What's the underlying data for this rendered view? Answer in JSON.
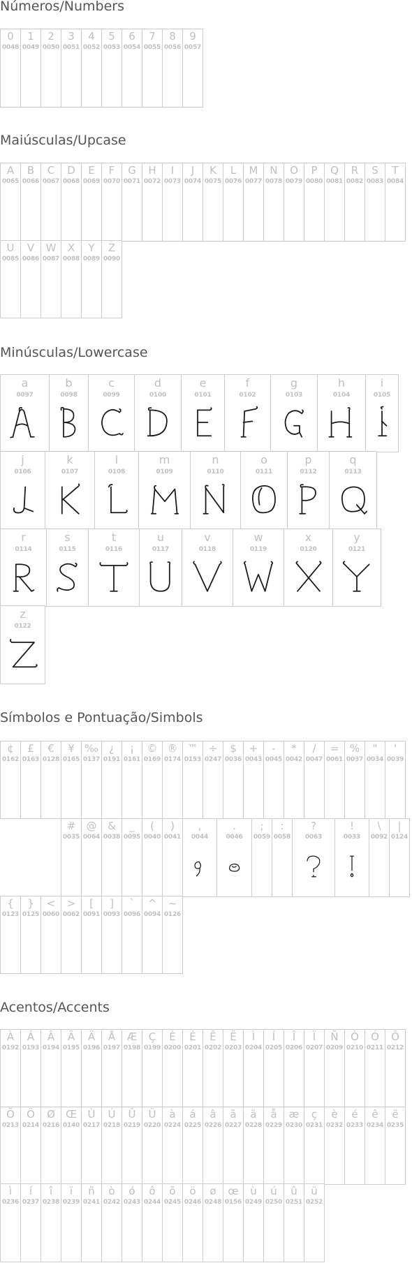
{
  "sections": {
    "numbers": {
      "title": "Números/Numbers",
      "cells": [
        {
          "ch": "0",
          "code": "0048"
        },
        {
          "ch": "1",
          "code": "0049"
        },
        {
          "ch": "2",
          "code": "0050"
        },
        {
          "ch": "3",
          "code": "0051"
        },
        {
          "ch": "4",
          "code": "0052"
        },
        {
          "ch": "5",
          "code": "0053"
        },
        {
          "ch": "6",
          "code": "0054"
        },
        {
          "ch": "7",
          "code": "0055"
        },
        {
          "ch": "8",
          "code": "0056"
        },
        {
          "ch": "9",
          "code": "0057"
        }
      ]
    },
    "upcase": {
      "title": "Maiúsculas/Upcase",
      "cells": [
        {
          "ch": "A",
          "code": "0065"
        },
        {
          "ch": "B",
          "code": "0066"
        },
        {
          "ch": "C",
          "code": "0067"
        },
        {
          "ch": "D",
          "code": "0068"
        },
        {
          "ch": "E",
          "code": "0069"
        },
        {
          "ch": "F",
          "code": "0070"
        },
        {
          "ch": "G",
          "code": "0071"
        },
        {
          "ch": "H",
          "code": "0072"
        },
        {
          "ch": "I",
          "code": "0073"
        },
        {
          "ch": "J",
          "code": "0074"
        },
        {
          "ch": "K",
          "code": "0075"
        },
        {
          "ch": "L",
          "code": "0076"
        },
        {
          "ch": "M",
          "code": "0077"
        },
        {
          "ch": "N",
          "code": "0078"
        },
        {
          "ch": "O",
          "code": "0079"
        },
        {
          "ch": "P",
          "code": "0080"
        },
        {
          "ch": "Q",
          "code": "0081"
        },
        {
          "ch": "R",
          "code": "0082"
        },
        {
          "ch": "S",
          "code": "0083"
        },
        {
          "ch": "T",
          "code": "0084"
        },
        {
          "ch": "U",
          "code": "0085"
        },
        {
          "ch": "V",
          "code": "0086"
        },
        {
          "ch": "W",
          "code": "0087"
        },
        {
          "ch": "X",
          "code": "0088"
        },
        {
          "ch": "Y",
          "code": "0089"
        },
        {
          "ch": "Z",
          "code": "0090"
        }
      ]
    },
    "lowercase": {
      "title": "Minúsculas/Lowercase",
      "cells": [
        {
          "ch": "a",
          "code": "0097",
          "glyph": "a"
        },
        {
          "ch": "b",
          "code": "0098",
          "glyph": "b"
        },
        {
          "ch": "c",
          "code": "0099",
          "glyph": "c"
        },
        {
          "ch": "d",
          "code": "0100",
          "glyph": "d"
        },
        {
          "ch": "e",
          "code": "0101",
          "glyph": "e"
        },
        {
          "ch": "f",
          "code": "0102",
          "glyph": "f"
        },
        {
          "ch": "g",
          "code": "0103",
          "glyph": "g"
        },
        {
          "ch": "h",
          "code": "0104",
          "glyph": "h"
        },
        {
          "ch": "i",
          "code": "0105",
          "glyph": "i"
        },
        {
          "ch": "j",
          "code": "0106",
          "glyph": "j"
        },
        {
          "ch": "k",
          "code": "0107",
          "glyph": "k"
        },
        {
          "ch": "l",
          "code": "0108",
          "glyph": "l"
        },
        {
          "ch": "m",
          "code": "0109",
          "glyph": "m"
        },
        {
          "ch": "n",
          "code": "0110",
          "glyph": "n"
        },
        {
          "ch": "o",
          "code": "0111",
          "glyph": "o"
        },
        {
          "ch": "p",
          "code": "0112",
          "glyph": "p"
        },
        {
          "ch": "q",
          "code": "0113",
          "glyph": "q"
        },
        {
          "ch": "r",
          "code": "0114",
          "glyph": "r"
        },
        {
          "ch": "s",
          "code": "0115",
          "glyph": "s"
        },
        {
          "ch": "t",
          "code": "0116",
          "glyph": "t"
        },
        {
          "ch": "u",
          "code": "0117",
          "glyph": "u"
        },
        {
          "ch": "v",
          "code": "0118",
          "glyph": "v"
        },
        {
          "ch": "w",
          "code": "0119",
          "glyph": "w"
        },
        {
          "ch": "x",
          "code": "0120",
          "glyph": "x"
        },
        {
          "ch": "y",
          "code": "0121",
          "glyph": "y"
        },
        {
          "ch": "z",
          "code": "0122",
          "glyph": "z"
        }
      ]
    },
    "symbols": {
      "title": "Símbolos e Pontuação/Simbols",
      "cells": [
        {
          "ch": "¢",
          "code": "0162"
        },
        {
          "ch": "£",
          "code": "0163"
        },
        {
          "ch": "€",
          "code": "0128"
        },
        {
          "ch": "¥",
          "code": "0165"
        },
        {
          "ch": "‰",
          "code": "0137"
        },
        {
          "ch": "¿",
          "code": "0191"
        },
        {
          "ch": "¡",
          "code": "0161"
        },
        {
          "ch": "©",
          "code": "0169"
        },
        {
          "ch": "®",
          "code": "0174"
        },
        {
          "ch": "™",
          "code": "0153"
        },
        {
          "ch": "÷",
          "code": "0247"
        },
        {
          "ch": "$",
          "code": "0036"
        },
        {
          "ch": "+",
          "code": "0043"
        },
        {
          "ch": "-",
          "code": "0045"
        },
        {
          "ch": "*",
          "code": "0042"
        },
        {
          "ch": "/",
          "code": "0047"
        },
        {
          "ch": "=",
          "code": "0061"
        },
        {
          "ch": "%",
          "code": "0037"
        },
        {
          "ch": "\"",
          "code": "0034"
        },
        {
          "ch": "'",
          "code": "0039"
        },
        {
          "ch": "#",
          "code": "0035"
        },
        {
          "ch": "@",
          "code": "0064"
        },
        {
          "ch": "&",
          "code": "0038"
        },
        {
          "ch": "_",
          "code": "0095"
        },
        {
          "ch": "(",
          "code": "0040"
        },
        {
          "ch": ")",
          "code": "0041"
        },
        {
          "ch": ",",
          "code": "0044",
          "glyph": "comma"
        },
        {
          "ch": ".",
          "code": "0046",
          "glyph": "period"
        },
        {
          "ch": ";",
          "code": "0059"
        },
        {
          "ch": ":",
          "code": "0058"
        },
        {
          "ch": "?",
          "code": "0063",
          "glyph": "question"
        },
        {
          "ch": "!",
          "code": "0033",
          "glyph": "exclam"
        },
        {
          "ch": "\\",
          "code": "0092"
        },
        {
          "ch": "|",
          "code": "0124"
        },
        {
          "ch": "{",
          "code": "0123"
        },
        {
          "ch": "}",
          "code": "0125"
        },
        {
          "ch": "<",
          "code": "0060"
        },
        {
          "ch": ">",
          "code": "0062"
        },
        {
          "ch": "[",
          "code": "0091"
        },
        {
          "ch": "]",
          "code": "0093"
        },
        {
          "ch": "`",
          "code": "0096"
        },
        {
          "ch": "^",
          "code": "0094"
        },
        {
          "ch": "~",
          "code": "0126"
        }
      ]
    },
    "accents": {
      "title": "Acentos/Accents",
      "cells": [
        {
          "ch": "À",
          "code": "0192"
        },
        {
          "ch": "Á",
          "code": "0193"
        },
        {
          "ch": "Â",
          "code": "0194"
        },
        {
          "ch": "Ã",
          "code": "0195"
        },
        {
          "ch": "Ä",
          "code": "0196"
        },
        {
          "ch": "Å",
          "code": "0197"
        },
        {
          "ch": "Æ",
          "code": "0198"
        },
        {
          "ch": "Ç",
          "code": "0199"
        },
        {
          "ch": "È",
          "code": "0200"
        },
        {
          "ch": "É",
          "code": "0201"
        },
        {
          "ch": "Ê",
          "code": "0202"
        },
        {
          "ch": "Ë",
          "code": "0203"
        },
        {
          "ch": "Ì",
          "code": "0204"
        },
        {
          "ch": "Í",
          "code": "0205"
        },
        {
          "ch": "Î",
          "code": "0206"
        },
        {
          "ch": "Ï",
          "code": "0207"
        },
        {
          "ch": "Ñ",
          "code": "0209"
        },
        {
          "ch": "Ò",
          "code": "0210"
        },
        {
          "ch": "Ó",
          "code": "0211"
        },
        {
          "ch": "Ô",
          "code": "0212"
        },
        {
          "ch": "Õ",
          "code": "0213"
        },
        {
          "ch": "Ö",
          "code": "0214"
        },
        {
          "ch": "Ø",
          "code": "0216"
        },
        {
          "ch": "Œ",
          "code": "0140"
        },
        {
          "ch": "Ù",
          "code": "0217"
        },
        {
          "ch": "Ú",
          "code": "0218"
        },
        {
          "ch": "Û",
          "code": "0219"
        },
        {
          "ch": "Ü",
          "code": "0220"
        },
        {
          "ch": "à",
          "code": "0224"
        },
        {
          "ch": "á",
          "code": "0225"
        },
        {
          "ch": "â",
          "code": "0226"
        },
        {
          "ch": "ã",
          "code": "0227"
        },
        {
          "ch": "ä",
          "code": "0228"
        },
        {
          "ch": "å",
          "code": "0229"
        },
        {
          "ch": "æ",
          "code": "0230"
        },
        {
          "ch": "ç",
          "code": "0231"
        },
        {
          "ch": "è",
          "code": "0232"
        },
        {
          "ch": "é",
          "code": "0233"
        },
        {
          "ch": "ê",
          "code": "0234"
        },
        {
          "ch": "ë",
          "code": "0235"
        },
        {
          "ch": "ì",
          "code": "0236"
        },
        {
          "ch": "í",
          "code": "0237"
        },
        {
          "ch": "î",
          "code": "0238"
        },
        {
          "ch": "ï",
          "code": "0239"
        },
        {
          "ch": "ñ",
          "code": "0241"
        },
        {
          "ch": "ò",
          "code": "0242"
        },
        {
          "ch": "ó",
          "code": "0243"
        },
        {
          "ch": "ô",
          "code": "0244"
        },
        {
          "ch": "õ",
          "code": "0245"
        },
        {
          "ch": "ö",
          "code": "0246"
        },
        {
          "ch": "ø",
          "code": "0248"
        },
        {
          "ch": "œ",
          "code": "0156"
        },
        {
          "ch": "ù",
          "code": "0249"
        },
        {
          "ch": "ú",
          "code": "0250"
        },
        {
          "ch": "û",
          "code": "0251"
        },
        {
          "ch": "ü",
          "code": "0252"
        }
      ]
    }
  },
  "colors": {
    "grid_border": "#cccccc",
    "label_text": "#c0c0c0",
    "title_text": "#555555",
    "glyph_stroke": "#1a1a1a"
  }
}
